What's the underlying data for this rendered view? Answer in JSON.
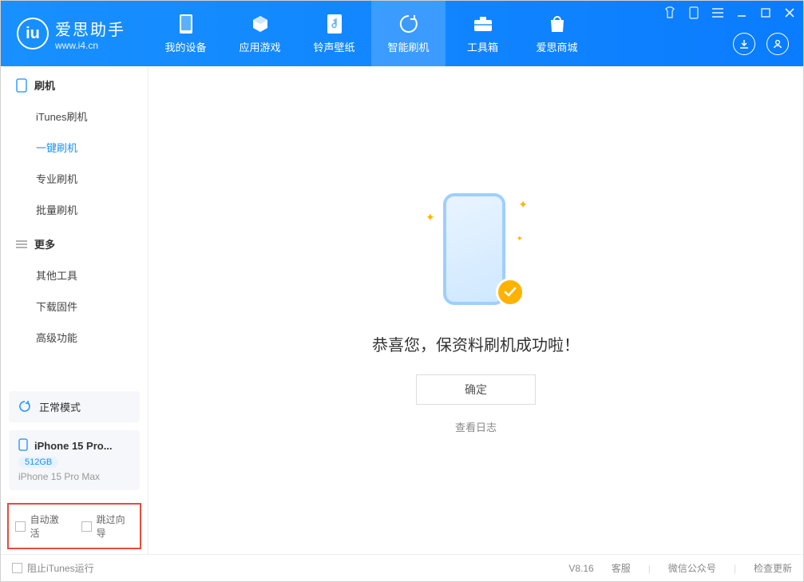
{
  "app": {
    "title": "爱思助手",
    "subtitle": "www.i4.cn",
    "version": "V8.16"
  },
  "nav": {
    "items": [
      {
        "label": "我的设备"
      },
      {
        "label": "应用游戏"
      },
      {
        "label": "铃声壁纸"
      },
      {
        "label": "智能刷机"
      },
      {
        "label": "工具箱"
      },
      {
        "label": "爱思商城"
      }
    ]
  },
  "sidebar": {
    "group1": {
      "title": "刷机"
    },
    "items1": [
      {
        "label": "iTunes刷机"
      },
      {
        "label": "一键刷机"
      },
      {
        "label": "专业刷机"
      },
      {
        "label": "批量刷机"
      }
    ],
    "group2": {
      "title": "更多"
    },
    "items2": [
      {
        "label": "其他工具"
      },
      {
        "label": "下载固件"
      },
      {
        "label": "高级功能"
      }
    ],
    "mode": "正常模式",
    "device": {
      "name": "iPhone 15 Pro...",
      "storage": "512GB",
      "full": "iPhone 15 Pro Max"
    },
    "checks": {
      "auto_activate": "自动激活",
      "skip_wizard": "跳过向导"
    }
  },
  "main": {
    "success": "恭喜您，保资料刷机成功啦！",
    "ok": "确定",
    "log": "查看日志"
  },
  "footer": {
    "block_itunes": "阻止iTunes运行",
    "support": "客服",
    "wechat": "微信公众号",
    "update": "检查更新"
  }
}
